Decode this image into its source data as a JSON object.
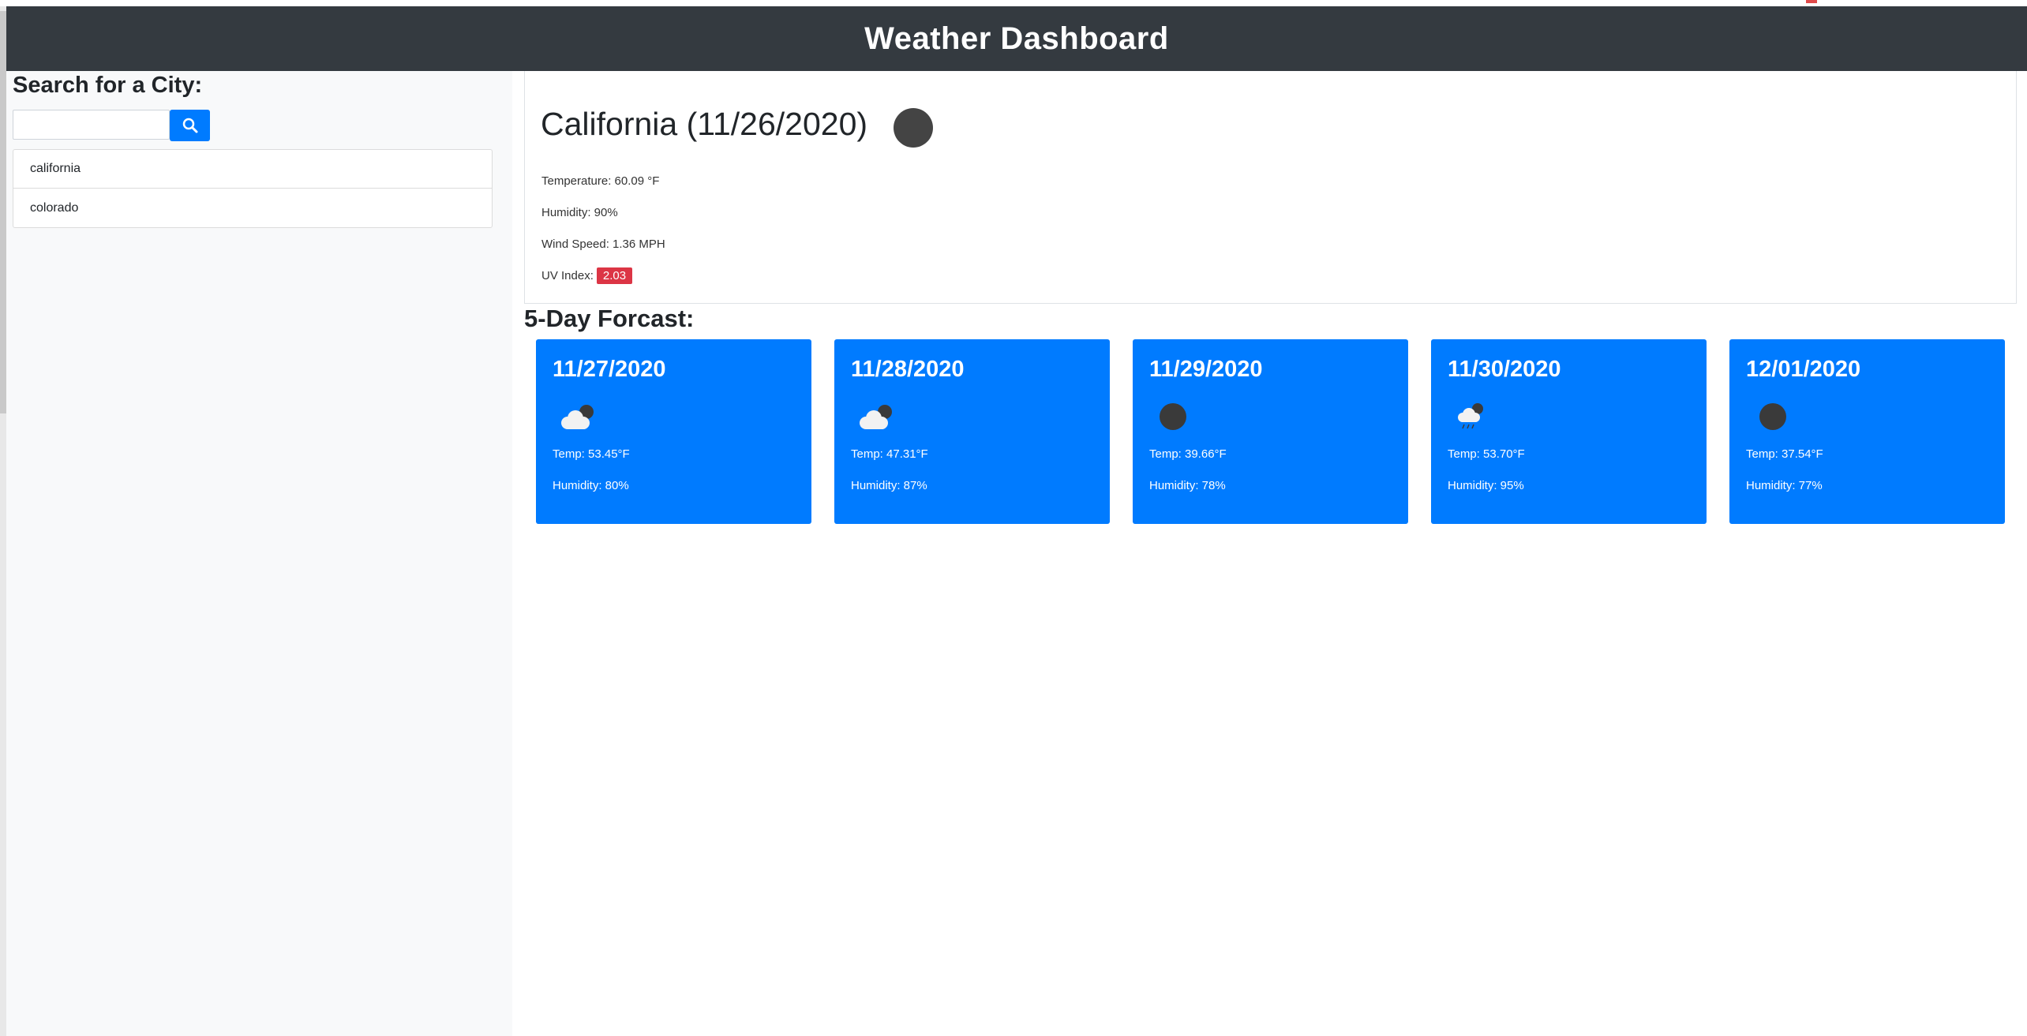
{
  "header": {
    "title": "Weather Dashboard"
  },
  "sidebar": {
    "search_title": "Search for a City:",
    "search_placeholder": "",
    "search_icon": "search-icon",
    "history": [
      "california",
      "colorado"
    ]
  },
  "current": {
    "title": "California (11/26/2020)",
    "icon": "weather-icon",
    "temperature": "Temperature: 60.09 °F",
    "humidity": "Humidity: 90%",
    "wind": "Wind Speed: 1.36 MPH",
    "uv_label": "UV Index:",
    "uv_value": "2.03"
  },
  "forecast": {
    "title": "5-Day Forcast:",
    "days": [
      {
        "date": "11/27/2020",
        "icon": "cloudy-night-icon",
        "temp": "Temp: 53.45°F",
        "humidity": "Humidity: 80%"
      },
      {
        "date": "11/28/2020",
        "icon": "cloudy-night-icon",
        "temp": "Temp: 47.31°F",
        "humidity": "Humidity: 87%"
      },
      {
        "date": "11/29/2020",
        "icon": "dark-circle-icon",
        "temp": "Temp: 39.66°F",
        "humidity": "Humidity: 78%"
      },
      {
        "date": "11/30/2020",
        "icon": "rain-icon",
        "temp": "Temp: 53.70°F",
        "humidity": "Humidity: 95%"
      },
      {
        "date": "12/01/2020",
        "icon": "dark-circle-icon",
        "temp": "Temp: 37.54°F",
        "humidity": "Humidity: 77%"
      }
    ]
  },
  "colors": {
    "header_bg": "#343a40",
    "accent": "#007bff",
    "uv_badge": "#dc3545",
    "sidebar_bg": "#f8f9fa"
  }
}
